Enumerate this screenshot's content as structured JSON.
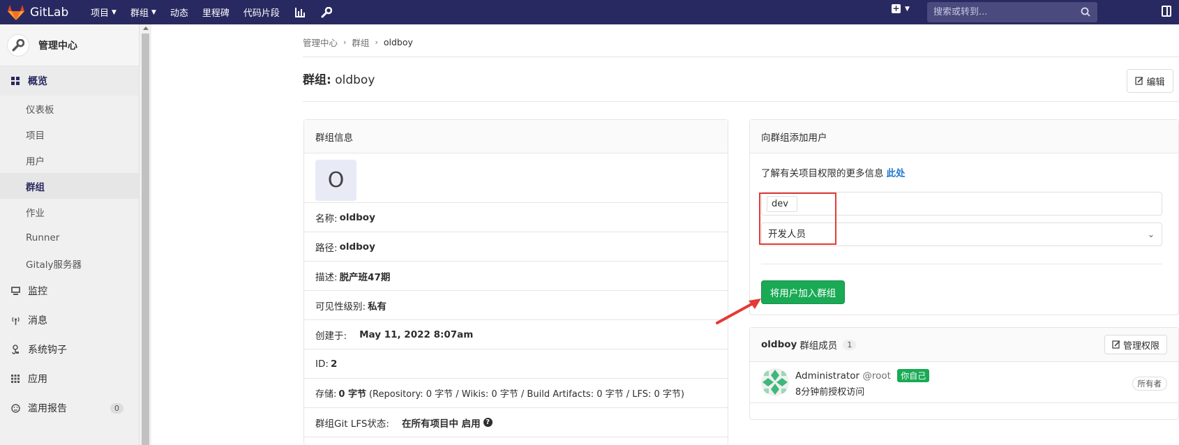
{
  "topnav": {
    "logo_text": "GitLab",
    "items": [
      {
        "label": "项目",
        "has_chevron": true
      },
      {
        "label": "群组",
        "has_chevron": true
      },
      {
        "label": "动态",
        "has_chevron": false
      },
      {
        "label": "里程碑",
        "has_chevron": false
      },
      {
        "label": "代码片段",
        "has_chevron": false
      }
    ],
    "icons": [
      "chart-icon",
      "wrench-icon"
    ],
    "search_placeholder": "搜索或转到..."
  },
  "sidebar": {
    "title": "管理中心",
    "sections": [
      {
        "label": "概览",
        "icon": "overview-icon",
        "active": true
      },
      {
        "label": "监控",
        "icon": "monitor-icon",
        "active": false
      },
      {
        "label": "消息",
        "icon": "broadcast-icon",
        "active": false
      },
      {
        "label": "系统钩子",
        "icon": "hook-icon",
        "active": false
      },
      {
        "label": "应用",
        "icon": "apps-icon",
        "active": false
      },
      {
        "label": "滥用报告",
        "icon": "report-icon",
        "active": false,
        "badge": "0"
      }
    ],
    "sub_items": [
      {
        "label": "仪表板",
        "active": false
      },
      {
        "label": "项目",
        "active": false
      },
      {
        "label": "用户",
        "active": false
      },
      {
        "label": "群组",
        "active": true
      },
      {
        "label": "作业",
        "active": false
      },
      {
        "label": "Runner",
        "active": false
      },
      {
        "label": "Gitaly服务器",
        "active": false
      }
    ]
  },
  "breadcrumb": [
    "管理中心",
    "群组",
    "oldboy"
  ],
  "page": {
    "title_prefix": "群组:",
    "title_name": "oldboy",
    "edit_label": "编辑"
  },
  "info": {
    "header": "群组信息",
    "avatar_letter": "O",
    "rows": [
      {
        "label": "名称:",
        "value": "oldboy",
        "extra": ""
      },
      {
        "label": "路径:",
        "value": "oldboy",
        "extra": ""
      },
      {
        "label": "描述:",
        "value": "脱产班47期",
        "extra": ""
      },
      {
        "label": "可见性级别:",
        "value": "私有",
        "extra": ""
      },
      {
        "label": "创建于:",
        "value": "May 11, 2022 8:07am",
        "extra": ""
      },
      {
        "label": "ID:",
        "value": "2",
        "extra": ""
      },
      {
        "label": "存储:",
        "value": "0 字节",
        "extra": "(Repository: 0 字节 / Wikis: 0 字节 / Build Artifacts: 0 字节 / LFS: 0 字节)"
      },
      {
        "label": "群组Git LFS状态:",
        "value": "在所有项目中 启用",
        "extra": ""
      }
    ]
  },
  "add_user": {
    "header": "向群组添加用户",
    "perm_text": "了解有关项目权限的更多信息",
    "perm_link": "此处",
    "user_token": "dev",
    "role_value": "开发人员",
    "button_label": "将用户加入群组"
  },
  "members": {
    "group_name": "oldboy",
    "header_suffix": "群组成员",
    "count": "1",
    "manage_label": "管理权限",
    "list": [
      {
        "name": "Administrator",
        "handle": "@root",
        "you": "你自己",
        "time": "8分钟前授权访问",
        "role": "所有者"
      }
    ]
  },
  "colors": {
    "nav_bg": "#292961",
    "success": "#1aaa55",
    "link": "#1f78d1",
    "annotation_red": "#e53935"
  }
}
